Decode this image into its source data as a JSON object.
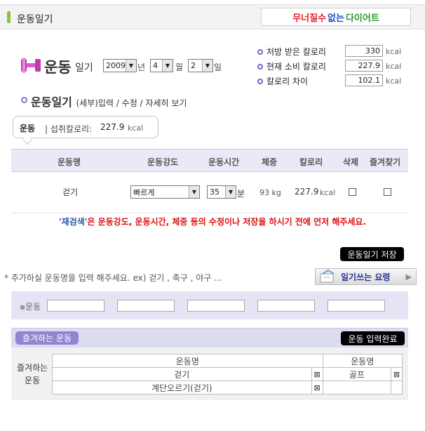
{
  "header": {
    "title": "운동일기",
    "banner": [
      "무너질수",
      "없는",
      "다이어트"
    ],
    "banner_colors": [
      "#e0202a",
      "#1a4fc0",
      "#2f9a2f"
    ]
  },
  "diary": {
    "title": "운동",
    "title_suffix": "일기",
    "year": "2009",
    "year_unit": "년",
    "month": "4",
    "month_unit": "월",
    "day": "2",
    "day_unit": "일"
  },
  "calories": {
    "items": [
      {
        "label": "처방 받은 칼로리",
        "value": "330",
        "unit": "kcal"
      },
      {
        "label": "현재 소비 칼로리",
        "value": "227.9",
        "unit": "kcal"
      },
      {
        "label": "칼로리 차이",
        "value": "102.1",
        "unit": "kcal"
      }
    ]
  },
  "section": {
    "title": "운동일기",
    "subtitle": "(세부)입력 / 수정 / 자세히 보기"
  },
  "bubble": {
    "category": "운동",
    "label": "| 섭취칼로리:",
    "value": "227.9",
    "unit": "kcal"
  },
  "table": {
    "headers": [
      "운동명",
      "운동강도",
      "운동시간",
      "체중",
      "칼로리",
      "삭제",
      "즐겨찾기"
    ],
    "row": {
      "name": "걷기",
      "intensity": "빠르게",
      "time": "35",
      "time_unit": "분",
      "weight": "93 kg",
      "calorie": "227.9",
      "calorie_unit": "kcal"
    }
  },
  "warning": {
    "highlight": "'재검색'",
    "text": "은 운동강도, 운동시간, 체중 등의 수정이나 저장을 하시기 전에 먼저 해주세요."
  },
  "buttons": {
    "save": "운동일기 저장",
    "guide": "일기쓰는 요령",
    "complete": "운동 입력완료"
  },
  "hint": "* 추가하실 운동명을 입력 해주세요. ex) 걷기 , 축구 , 야구 ...",
  "exercise_input": {
    "label": "운동"
  },
  "favorites": {
    "title": "즐겨하는 운동",
    "side_label_1": "즐겨하는",
    "side_label_2": "운동",
    "col_header": "운동명",
    "col_header_2": "운동명",
    "left_items": [
      "걷기",
      "계단오르기(걷기)"
    ],
    "right_items": [
      "골프",
      ""
    ]
  }
}
